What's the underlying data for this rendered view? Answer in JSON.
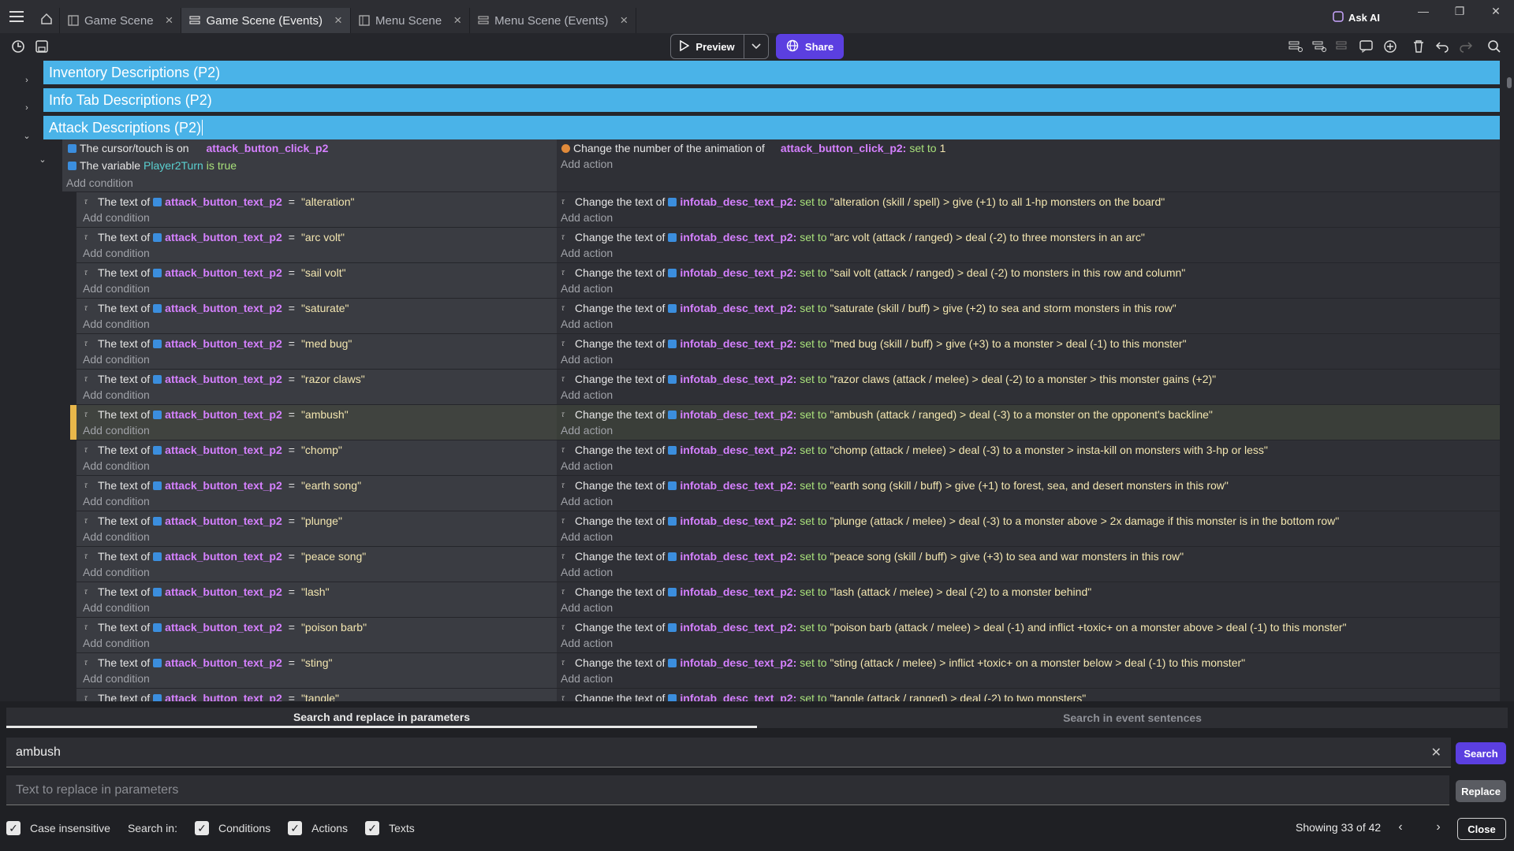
{
  "tabs": [
    {
      "label": "Game Scene",
      "active": false
    },
    {
      "label": "Game Scene (Events)",
      "active": true
    },
    {
      "label": "Menu Scene",
      "active": false
    },
    {
      "label": "Menu Scene (Events)",
      "active": false
    }
  ],
  "ask_ai": "Ask AI",
  "toolbar": {
    "preview": "Preview",
    "share": "Share"
  },
  "groups": [
    {
      "title": "Inventory Descriptions (P2)"
    },
    {
      "title": "Info Tab Descriptions (P2)"
    },
    {
      "title": "Attack Descriptions (P2)"
    }
  ],
  "parent_event": {
    "cond1_text": "The cursor/touch is on",
    "cond1_obj": "attack_button_click_p2",
    "cond2_text": "The variable",
    "cond2_var": "Player2Turn",
    "cond2_is": "is",
    "cond2_val": "true",
    "add_condition": "Add condition",
    "action_text": "Change the number of the animation of",
    "action_obj": "attack_button_click_p2:",
    "action_set": "set to",
    "action_val": "1",
    "add_action": "Add action"
  },
  "labels": {
    "text_of": "The text of",
    "change_text_of": "Change the text of",
    "set_to": "set to",
    "equals": "=",
    "add_condition": "Add condition",
    "add_action": "Add action",
    "cond_obj": "attack_button_text_p2",
    "act_obj": "infotab_desc_text_p2:"
  },
  "sub_events": [
    {
      "name": "\"alteration\"",
      "desc": "\"alteration (skill / spell) > give (+1) to all 1-hp monsters on the board\""
    },
    {
      "name": "\"arc volt\"",
      "desc": "\"arc volt (attack / ranged) > deal (-2) to three monsters in an arc\""
    },
    {
      "name": "\"sail volt\"",
      "desc": "\"sail volt (attack / ranged) > deal (-2) to monsters in this row and column\""
    },
    {
      "name": "\"saturate\"",
      "desc": "\"saturate (skill / buff) > give (+2) to sea and storm monsters in this row\""
    },
    {
      "name": "\"med bug\"",
      "desc": "\"med bug (skill / buff) > give (+3) to a monster > deal (-1) to this monster\""
    },
    {
      "name": "\"razor claws\"",
      "desc": "\"razor claws (attack / melee) > deal (-2) to a monster > this monster gains (+2)\""
    },
    {
      "name": "\"ambush\"",
      "desc": "\"ambush (attack / ranged) > deal (-3) to a monster on the opponent's backline\"",
      "highlight": true
    },
    {
      "name": "\"chomp\"",
      "desc": "\"chomp (attack / melee) > deal (-3) to a monster > insta-kill on monsters with 3-hp or less\""
    },
    {
      "name": "\"earth song\"",
      "desc": "\"earth song (skill / buff) > give (+1) to forest, sea, and desert monsters in this row\""
    },
    {
      "name": "\"plunge\"",
      "desc": "\"plunge (attack / melee) > deal (-3) to a monster above > 2x damage if this monster is in the bottom row\""
    },
    {
      "name": "\"peace song\"",
      "desc": "\"peace song (skill / buff) > give (+3) to sea and war monsters in this row\""
    },
    {
      "name": "\"lash\"",
      "desc": "\"lash (attack / melee) > deal (-2) to a monster behind\""
    },
    {
      "name": "\"poison barb\"",
      "desc": "\"poison barb (attack / melee) > deal (-1) and inflict +toxic+ on a monster above > deal (-1) to this monster\""
    },
    {
      "name": "\"sting\"",
      "desc": "\"sting (attack / melee) > inflict +toxic+ on a monster below > deal (-1) to this monster\""
    },
    {
      "name": "\"tangle\"",
      "desc": "\"tangle (attack / ranged) > deal (-2) to two monsters\""
    }
  ],
  "search_panel": {
    "tab1": "Search and replace in parameters",
    "tab2": "Search in event sentences",
    "search_value": "ambush",
    "replace_placeholder": "Text to replace in parameters",
    "search_button": "Search",
    "replace_button": "Replace",
    "case_insensitive": "Case insensitive",
    "search_in": "Search in:",
    "conditions": "Conditions",
    "actions": "Actions",
    "texts": "Texts",
    "showing": "Showing 33 of 42",
    "close": "Close"
  },
  "colors": {
    "accent": "#5b3fe0",
    "group": "#4ab3e8",
    "object": "#d580ff",
    "highlight": "#e8b74a"
  }
}
